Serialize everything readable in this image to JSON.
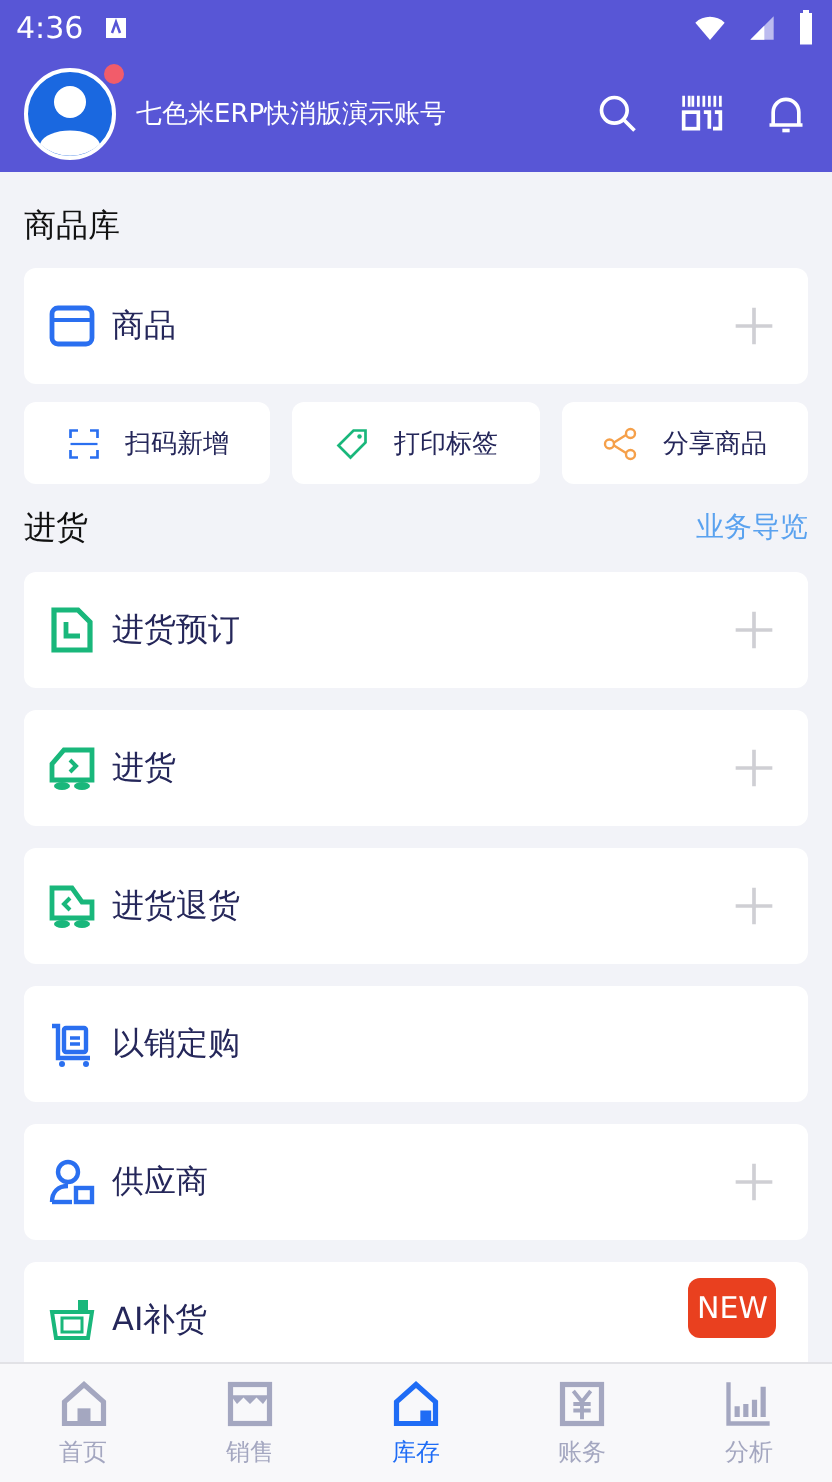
{
  "status_bar": {
    "time": "4:36"
  },
  "header": {
    "account": "七色米ERP快消版演示账号",
    "notification_dot": true
  },
  "product_section": {
    "title": "商品库",
    "items": [
      {
        "label": "商品",
        "kind": "box",
        "add": true
      }
    ],
    "quick_actions": [
      {
        "label": "扫码新增",
        "kind": "scan"
      },
      {
        "label": "打印标签",
        "kind": "tag"
      },
      {
        "label": "分享商品",
        "kind": "share"
      }
    ]
  },
  "purchase_section": {
    "title": "进货",
    "link": "业务导览",
    "items": [
      {
        "label": "进货预订",
        "kind": "doc",
        "add": true
      },
      {
        "label": "进货",
        "kind": "truck-in",
        "add": true
      },
      {
        "label": "进货退货",
        "kind": "truck-out",
        "add": true
      },
      {
        "label": "以销定购",
        "kind": "cart",
        "add": false
      },
      {
        "label": "供应商",
        "kind": "person",
        "add": true
      },
      {
        "label": "AI补货",
        "kind": "basket",
        "add": false,
        "badge": "NEW"
      }
    ]
  },
  "tab_bar": [
    {
      "label": "首页",
      "kind": "home",
      "selected": false
    },
    {
      "label": "销售",
      "kind": "store",
      "selected": false
    },
    {
      "label": "库存",
      "kind": "warehouse",
      "selected": true
    },
    {
      "label": "账务",
      "kind": "yen",
      "selected": false
    },
    {
      "label": "分析",
      "kind": "chart",
      "selected": false
    }
  ]
}
